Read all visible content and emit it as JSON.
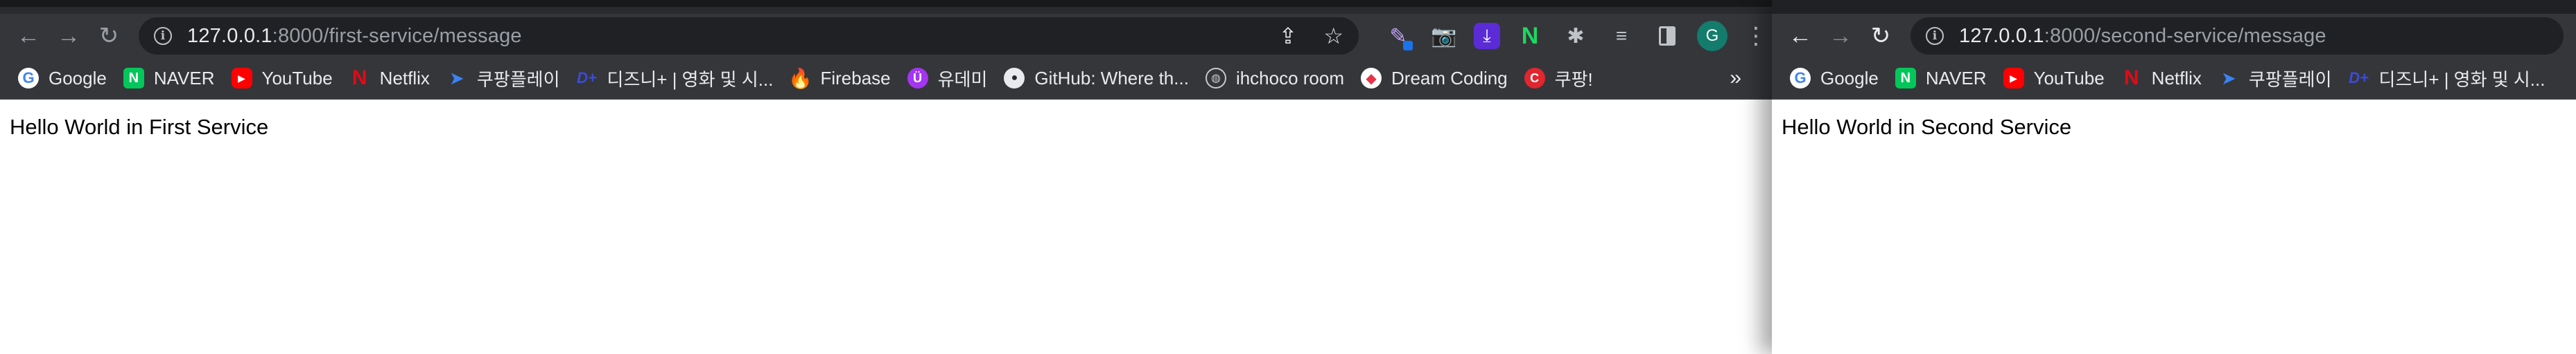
{
  "left_window": {
    "nav": {
      "back": "←",
      "forward": "→",
      "reload": "↻"
    },
    "address_bar": {
      "host": "127.0.0.1",
      "path": ":8000/first-service/message"
    },
    "extensions": {
      "pen": "✎",
      "camera": "📷",
      "download": "⤓",
      "n": "N",
      "puzzle": "✱",
      "media": "≡",
      "avatar": "G",
      "menu": "⋮"
    },
    "bookmarks": [
      {
        "label": "Google",
        "icon": "G"
      },
      {
        "label": "NAVER",
        "icon": "N"
      },
      {
        "label": "YouTube",
        "icon": "▶"
      },
      {
        "label": "Netflix",
        "icon": "N"
      },
      {
        "label": "쿠팡플레이",
        "icon": "➤"
      },
      {
        "label": "디즈니+ | 영화 및 시...",
        "icon": "D+"
      },
      {
        "label": "Firebase",
        "icon": "🔥"
      },
      {
        "label": "유데미",
        "icon": "Ü"
      },
      {
        "label": "GitHub: Where th...",
        "icon": "●"
      },
      {
        "label": "ihchoco room",
        "icon": "◍"
      },
      {
        "label": "Dream Coding",
        "icon": "◆"
      },
      {
        "label": "쿠팡!",
        "icon": "C"
      }
    ],
    "overflow": "»",
    "content": "Hello World in First Service"
  },
  "right_window": {
    "nav": {
      "back": "←",
      "forward": "→",
      "reload": "↻"
    },
    "address_bar": {
      "host": "127.0.0.1",
      "path": ":8000/second-service/message"
    },
    "bookmarks": [
      {
        "label": "Google",
        "icon": "G"
      },
      {
        "label": "NAVER",
        "icon": "N"
      },
      {
        "label": "YouTube",
        "icon": "▶"
      },
      {
        "label": "Netflix",
        "icon": "N"
      },
      {
        "label": "쿠팡플레이",
        "icon": "➤"
      },
      {
        "label": "디즈니+ | 영화 및 시...",
        "icon": "D+"
      }
    ],
    "content": "Hello World in Second Service"
  },
  "colors": {
    "toolbar": "#35363a",
    "omnibox": "#202124",
    "avatar": "#137c6c"
  }
}
